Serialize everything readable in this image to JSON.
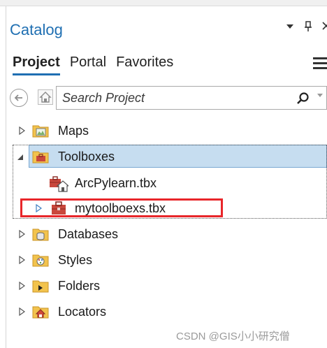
{
  "pane": {
    "title": "Catalog",
    "window_controls": [
      "options-arrow",
      "pin",
      "close"
    ]
  },
  "tabs": [
    {
      "label": "Project",
      "active": true
    },
    {
      "label": "Portal",
      "active": false
    },
    {
      "label": "Favorites",
      "active": false
    }
  ],
  "search": {
    "placeholder": "Search Project"
  },
  "tree": {
    "maps": "Maps",
    "toolboxes": "Toolboxes",
    "toolbox_child_1": "ArcPylearn.tbx",
    "toolbox_child_2": "mytoolboexs.tbx",
    "databases": "Databases",
    "styles": "Styles",
    "folders": "Folders",
    "locators": "Locators"
  },
  "state": {
    "selected_item": "Toolboxes",
    "highlighted_item": "mytoolboexs.tbx"
  },
  "colors": {
    "accent": "#1f6fb2",
    "selection": "#c6ddf0",
    "highlight_box": "#e8262a",
    "folder": "#f2c34d",
    "toolbox": "#c9473c"
  },
  "watermark": "CSDN @GIS小小研究僧"
}
